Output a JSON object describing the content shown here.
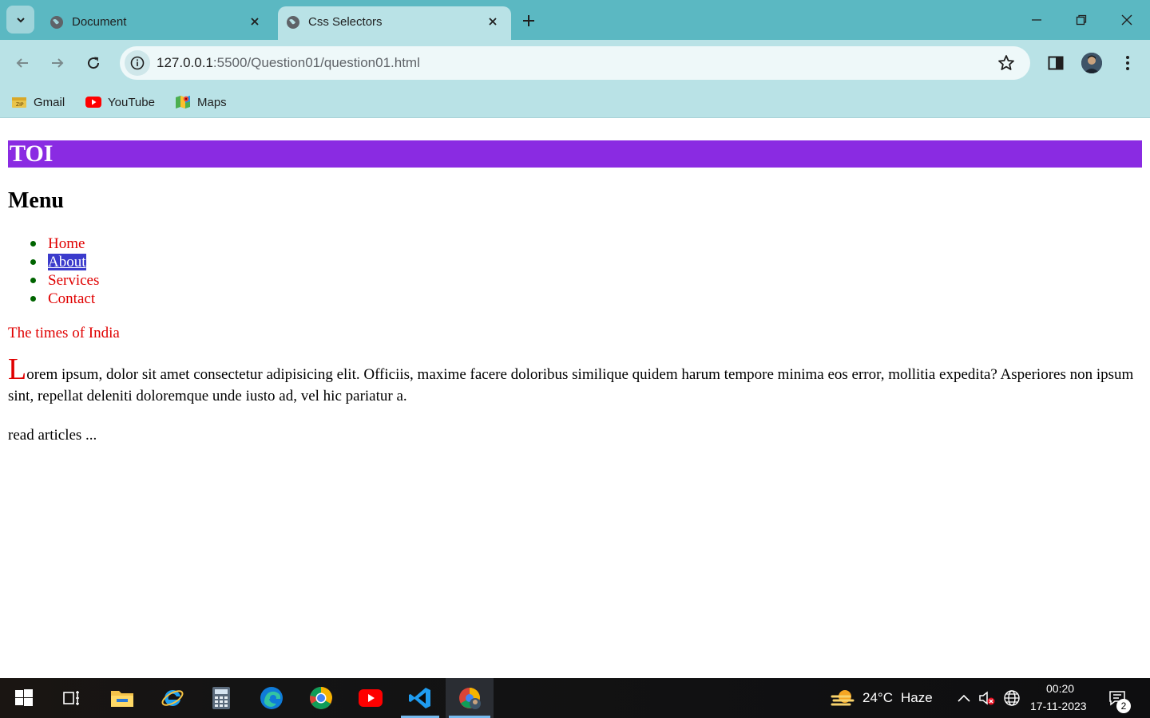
{
  "browser": {
    "tabs": [
      {
        "title": "Document",
        "active": false
      },
      {
        "title": "Css Selectors",
        "active": true
      }
    ],
    "url_host": "127.0.0.1",
    "url_rest": ":5500/Question01/question01.html",
    "bookmarks": [
      {
        "label": "Gmail",
        "icon": "gmail-icon"
      },
      {
        "label": "YouTube",
        "icon": "youtube-icon"
      },
      {
        "label": "Maps",
        "icon": "maps-icon"
      }
    ],
    "colors": {
      "titlebar": "#5bb8c2",
      "toolbar": "#b9e2e6"
    }
  },
  "page": {
    "brand": "TOI",
    "menu_heading": "Menu",
    "menu_items": [
      "Home",
      "About",
      "Services",
      "Contact"
    ],
    "hovered_item": "About",
    "tagline": "The times of India",
    "paragraph_first_letter": "L",
    "paragraph_rest": "orem ipsum, dolor sit amet consectetur adipisicing elit. Officiis, maxime facere doloribus similique quidem harum tempore minima eos error, mollitia expedita? Asperiores non ipsum sint, repellat deleniti doloremque unde iusto ad, vel hic pariatur a.",
    "read_more": "read articles ...",
    "colors": {
      "brand_bar": "#8a2be2",
      "link": "#e00000",
      "bullet": "#006400",
      "hover_bg": "#3b3bcc"
    }
  },
  "taskbar": {
    "weather_temp": "24°C",
    "weather_condition": "Haze",
    "time": "00:20",
    "date": "17-11-2023",
    "notifications": "2"
  }
}
